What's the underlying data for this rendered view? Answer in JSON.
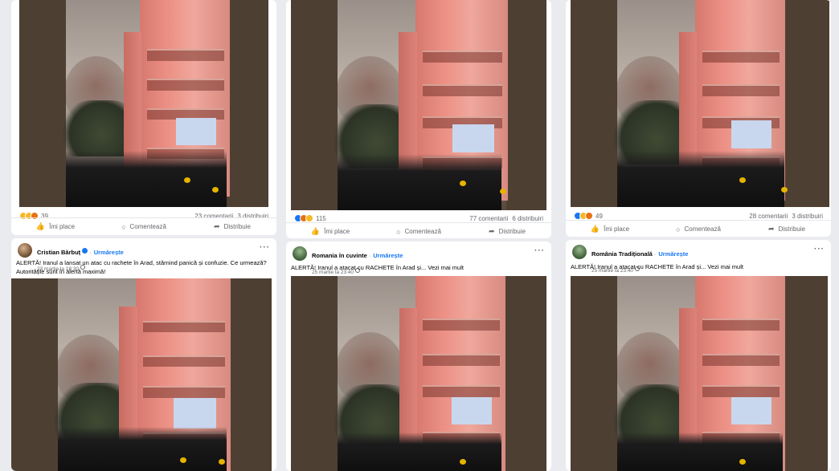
{
  "colors": {
    "background": "#e9ebef",
    "card": "#ffffff",
    "link": "#1877f2",
    "secondary_text": "#65676b",
    "photo_frame": "#4e3f33",
    "building": "#ec8f84"
  },
  "columns": [
    {
      "top_post": {
        "reactions": {
          "icons": [
            "haha-reaction-icon",
            "sad-reaction-icon",
            "angry-reaction-icon"
          ],
          "count": "39"
        },
        "comments": "23 comentarii",
        "shares": "3 distribuiri"
      },
      "actions": {
        "like": "Îmi place",
        "comment": "Comentează",
        "share": "Distribuie"
      },
      "post": {
        "author": "Cristian Bărbuț",
        "verified": true,
        "follow": "Urmărește",
        "date": "23 martie la 18:30",
        "text": "ALERTĂ! Iranul a lansat un atac cu rachete în Arad, stârnind panică și confuzie. Ce urmează? Autoritățile sunt în alertă maximă!"
      }
    },
    {
      "top_post": {
        "reactions": {
          "icons": [
            "like-reaction-icon",
            "angry-reaction-icon",
            "haha-reaction-icon"
          ],
          "count": "115"
        },
        "comments": "77 comentarii",
        "shares": "6 distribuiri"
      },
      "actions": {
        "like": "Îmi place",
        "comment": "Comentează",
        "share": "Distribuie"
      },
      "post": {
        "author": "Romania în cuvinte",
        "follow": "Urmărește",
        "date": "25 martie la 23:40",
        "text": "ALERTĂ! Iranul a atacat cu RACHETE în Arad și... Vezi mai mult"
      }
    },
    {
      "top_post": {
        "reactions": {
          "icons": [
            "like-reaction-icon",
            "sad-reaction-icon",
            "angry-reaction-icon"
          ],
          "count": "49"
        },
        "comments": "28 comentarii",
        "shares": "3 distribuiri"
      },
      "actions": {
        "like": "Îmi place",
        "comment": "Comentează",
        "share": "Distribuie"
      },
      "post": {
        "author": "România Tradițională",
        "follow": "Urmărește",
        "date": "25 martie la 23:40",
        "text": "ALERTĂ! Iranul a atacat cu RACHETE în Arad și... Vezi mai mult"
      }
    }
  ]
}
